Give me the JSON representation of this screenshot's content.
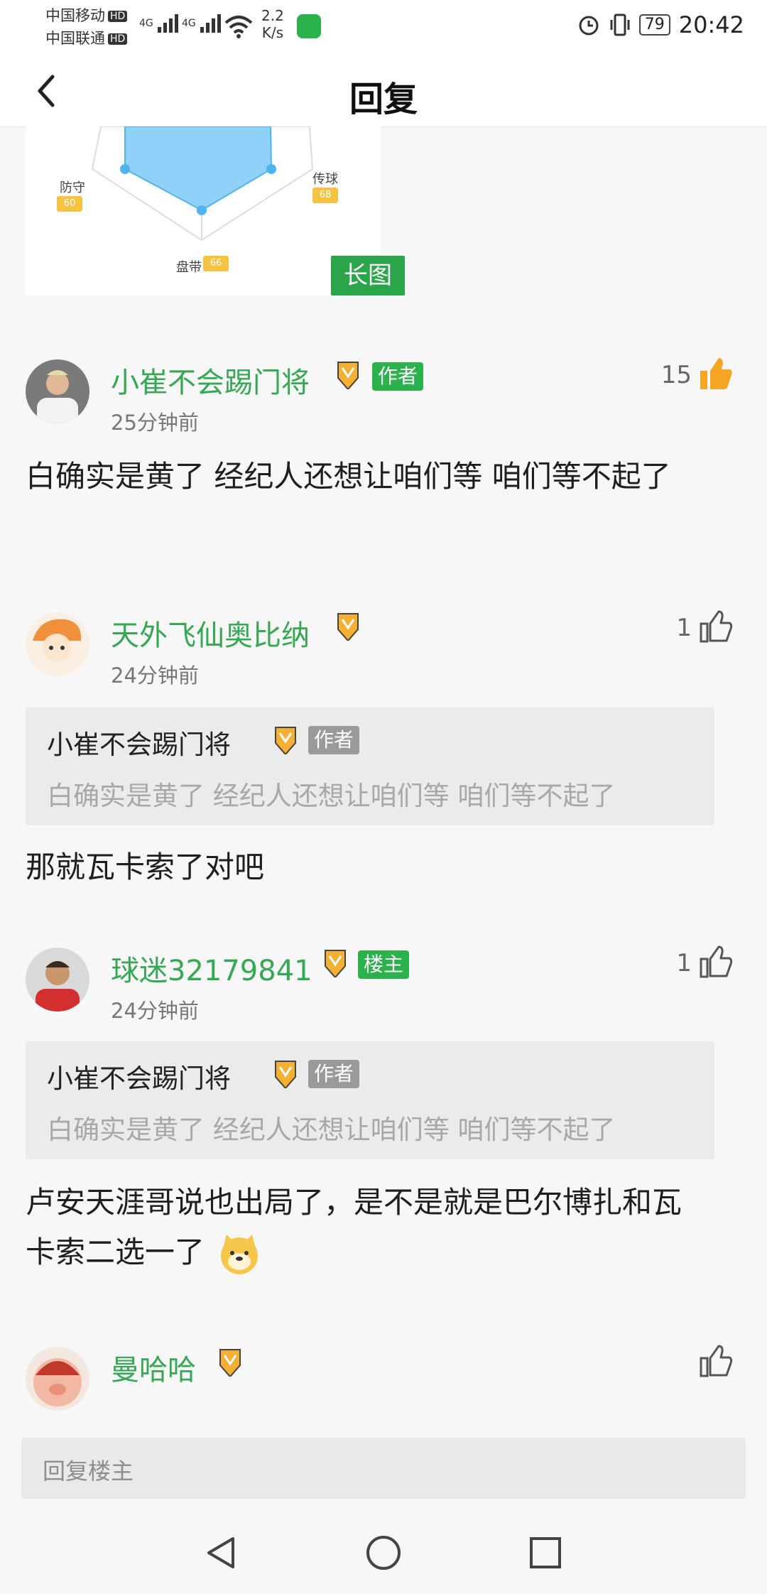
{
  "status_bar": {
    "carrier1": "中国移动",
    "carrier2": "中国联通",
    "hd": "HD",
    "net1": "4G",
    "net2": "4G",
    "speed_value": "2.2",
    "speed_unit": "K/s",
    "battery": "79",
    "time": "20:42"
  },
  "header": {
    "title": "回复"
  },
  "image_card": {
    "labels": {
      "defense": "防守",
      "pass": "传球",
      "dribble": "盘带"
    },
    "values": {
      "defense": "60",
      "pass": "68",
      "dribble": "66"
    },
    "badge": "长图"
  },
  "comments": [
    {
      "username": "小崔不会踢门将",
      "tag": "作者",
      "time": "25分钟前",
      "likes": "15",
      "content": "白确实是黄了 经纪人还想让咱们等 咱们等不起了"
    },
    {
      "username": "天外飞仙奥比纳",
      "time": "24分钟前",
      "likes": "1",
      "quote": {
        "username": "小崔不会踢门将",
        "tag": "作者",
        "text": "白确实是黄了 经纪人还想让咱们等 咱们等不起了"
      },
      "content": "那就瓦卡索了对吧"
    },
    {
      "username": "球迷32179841",
      "tag": "楼主",
      "time": "24分钟前",
      "likes": "1",
      "quote": {
        "username": "小崔不会踢门将",
        "tag": "作者",
        "text": "白确实是黄了 经纪人还想让咱们等 咱们等不起了"
      },
      "content": "卢安天涯哥说也出局了，是不是就是巴尔博扎和瓦卡索二选一了"
    },
    {
      "username": "曼哈哈",
      "time": "",
      "likes": ""
    }
  ],
  "reply_bar": {
    "placeholder": "回复楼主"
  },
  "colors": {
    "accent_green": "#2bb24c",
    "like_orange": "#f5a623",
    "username_green": "#34a853"
  }
}
